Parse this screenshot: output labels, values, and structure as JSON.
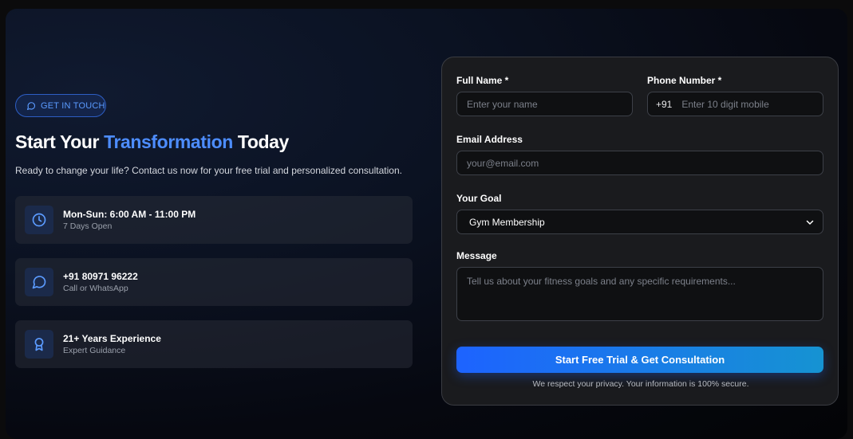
{
  "badge": {
    "label": "GET IN TOUCH",
    "icon": "chat-bubble-icon"
  },
  "headline": {
    "before": "Start Your ",
    "accent": "Transformation",
    "after": " Today"
  },
  "subtitle": "Ready to change your life? Contact us now for your free trial and personalized consultation.",
  "info_cards": [
    {
      "icon": "clock-icon",
      "title": "Mon-Sun: 6:00 AM - 11:00 PM",
      "subtitle": "7 Days Open"
    },
    {
      "icon": "chat-bubble-icon",
      "title": "+91 80971 96222",
      "subtitle": "Call or WhatsApp"
    },
    {
      "icon": "award-icon",
      "title": "21+ Years Experience",
      "subtitle": "Expert Guidance"
    }
  ],
  "form": {
    "full_name": {
      "label": "Full Name *",
      "placeholder": "Enter your name"
    },
    "phone": {
      "label": "Phone Number *",
      "prefix": "+91",
      "placeholder": "Enter 10 digit mobile"
    },
    "email": {
      "label": "Email Address",
      "placeholder": "your@email.com"
    },
    "goal": {
      "label": "Your Goal",
      "selected": "Gym Membership"
    },
    "message": {
      "label": "Message",
      "placeholder": "Tell us about your fitness goals and any specific requirements..."
    },
    "submit_label": "Start Free Trial & Get Consultation",
    "privacy_note": "We respect your privacy. Your information is 100% secure."
  },
  "colors": {
    "accent": "#4d8dff",
    "button_start": "#1d63ff",
    "button_end": "#1693d2"
  }
}
